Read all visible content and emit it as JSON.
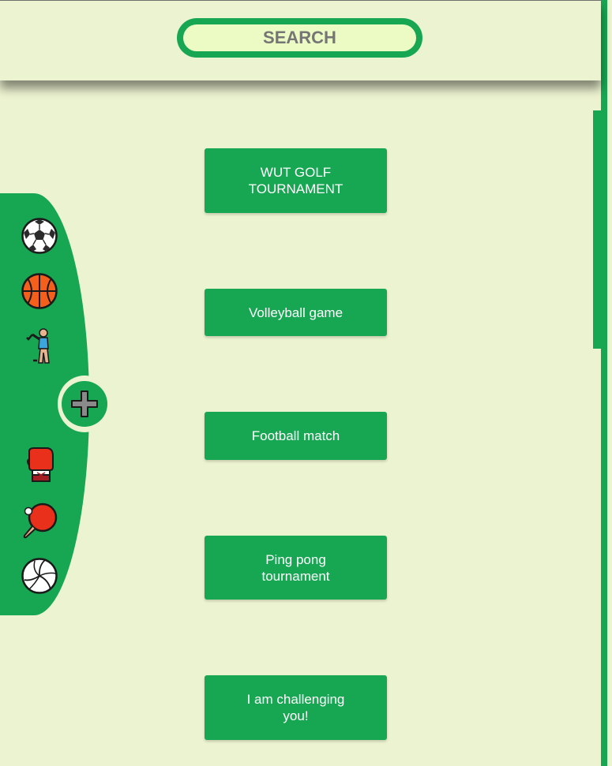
{
  "search": {
    "placeholder": "SEARCH",
    "value": ""
  },
  "sidebar": {
    "icons": [
      "soccer-ball-icon",
      "basketball-icon",
      "golfer-icon",
      "boxing-glove-icon",
      "ping-pong-icon",
      "volleyball-icon"
    ],
    "add_button_icon": "plus-icon"
  },
  "events": [
    {
      "label": "WUT GOLF TOURNAMENT"
    },
    {
      "label": "Volleyball game"
    },
    {
      "label": "Football match"
    },
    {
      "label": "Ping pong tournament"
    },
    {
      "label": "I am challenging you!"
    }
  ],
  "colors": {
    "accent": "#17a652",
    "background": "#ecf3d0",
    "search_fill": "#ecfbc4",
    "search_text": "#6e6e6e"
  }
}
